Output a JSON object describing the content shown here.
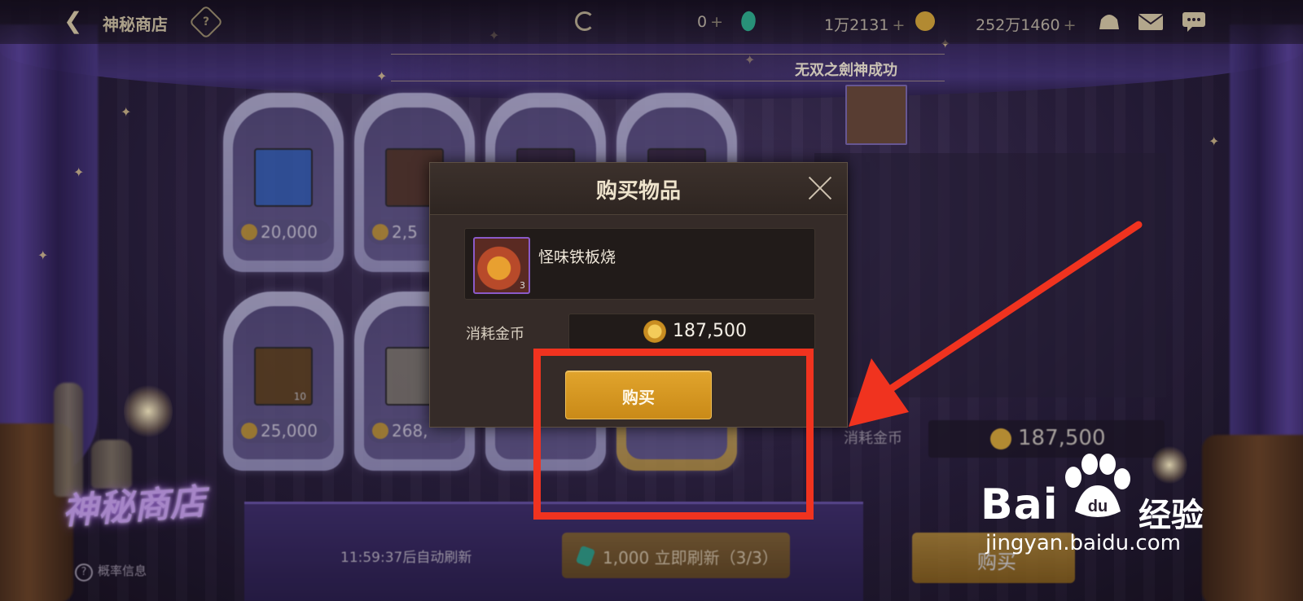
{
  "topbar": {
    "title": "神秘商店",
    "help_symbol": "?",
    "currency_a": "0",
    "currency_b": "1万2131",
    "currency_c": "252万1460",
    "plus": "+"
  },
  "banner": {
    "message": "无双之劍神成功"
  },
  "shop_cards": [
    {
      "price": "20,000",
      "thumb_color": "#3a6ac8"
    },
    {
      "price": "2,5",
      "thumb_color": "#5a3a28"
    },
    {
      "price": "",
      "thumb_color": "#3a2a44"
    },
    {
      "price": "",
      "thumb_color": "#3a2a44"
    },
    {
      "price": "25,000",
      "thumb_color": "#6a4a20",
      "qty": "10"
    },
    {
      "price": "268,",
      "thumb_color": "#8a8478"
    }
  ],
  "background": {
    "cost_label": "消耗金币",
    "cost_value": "187,500",
    "refresh_timer": "11:59:37后自动刷新",
    "refresh_button": "1,000 立即刷新（3/3）",
    "buy_button": "购买",
    "logo": "神秘商店",
    "prob_info": "概率信息",
    "prob_symbol": "?"
  },
  "modal": {
    "title": "购买物品",
    "item_name": "怪味铁板烧",
    "item_qty": "3",
    "cost_label": "消耗金币",
    "cost_value": "187,500",
    "buy_label": "购买"
  },
  "watermark": {
    "brand_left": "Bai",
    "brand_right": "经验",
    "url": "jingyan.baidu.com"
  },
  "colors": {
    "accent_gold": "#e1a42c",
    "annotation_red": "#f0331f",
    "coin": "#d7a83a",
    "gem": "#2fb08f"
  }
}
